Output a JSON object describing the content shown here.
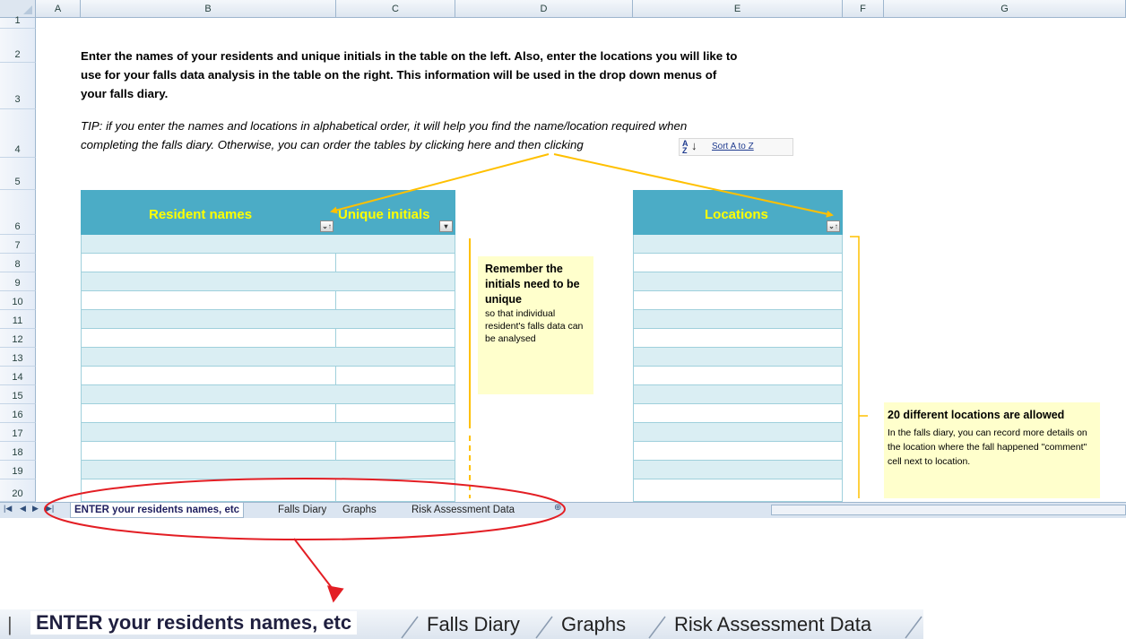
{
  "columns": [
    "A",
    "B",
    "C",
    "D",
    "E",
    "F",
    "G"
  ],
  "rows": [
    "1",
    "2",
    "3",
    "4",
    "5",
    "6",
    "7",
    "8",
    "9",
    "10",
    "11",
    "12",
    "13",
    "14",
    "15",
    "16",
    "17",
    "18",
    "19",
    "20"
  ],
  "instructions": {
    "line1": "Enter the names of your residents and unique initials in the table on the left. Also, enter the locations you will like to",
    "line2": "use for your falls data analysis in the table on the right. This information will be used in the drop down menus of",
    "line3": "your falls diary."
  },
  "tip": {
    "line1": "TIP: if you enter the names and locations in alphabetical order, it will help you find the name/location required when",
    "line2": "completing the falls diary. Otherwise, you can order the tables by clicking here and then clicking"
  },
  "sort_button": {
    "icon": "sort-az-icon",
    "label": "Sort A to Z"
  },
  "residents_table": {
    "col1_header": "Resident names",
    "col2_header": "Unique initials"
  },
  "locations_table": {
    "header": "Locations"
  },
  "note_initials": {
    "title": "Remember the initials need to be unique",
    "body": "so that individual resident's falls data can be analysed"
  },
  "note_locations": {
    "title": "20 different locations are allowed",
    "body": "In the falls diary, you can record more details on the location where the fall happened \"comment\" cell next to location."
  },
  "sheet_tabs": [
    "ENTER your residents names, etc",
    "Falls Diary",
    "Graphs",
    "Risk Assessment Data"
  ],
  "zoom_tabs": [
    "ENTER your residents names, etc",
    "Falls Diary",
    "Graphs",
    "Risk Assessment Data"
  ],
  "colors": {
    "table_header": "#4bacc6",
    "header_text": "#ffff00",
    "band": "#daeef3",
    "annotation": "#ffc000",
    "circle": "#e31e24"
  }
}
